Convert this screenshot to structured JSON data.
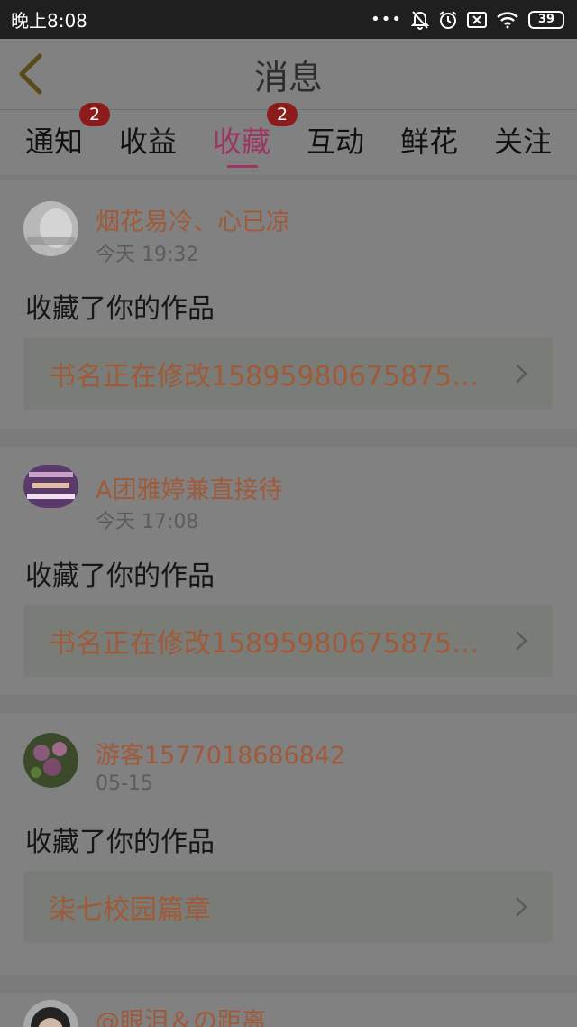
{
  "status_bar": {
    "time": "晚上8:08",
    "icons": [
      "more-dots-icon",
      "mute-bell-icon",
      "alarm-icon",
      "sim-x-icon",
      "wifi-icon"
    ],
    "battery": "39"
  },
  "header": {
    "back_icon": "chevron-left-icon",
    "title": "消息"
  },
  "tabs": [
    {
      "label": "通知",
      "badge": "2"
    },
    {
      "label": "收益",
      "badge": ""
    },
    {
      "label": "收藏",
      "badge": "2",
      "active": true
    },
    {
      "label": "互动",
      "badge": ""
    },
    {
      "label": "鲜花",
      "badge": ""
    },
    {
      "label": "关注",
      "badge": ""
    }
  ],
  "colors": {
    "accent": "#9c3660",
    "badge": "#8c1c1c",
    "username": "#a05a3a"
  },
  "messages": [
    {
      "username": "烟花易冷、心已凉",
      "time": "今天 19:32",
      "action": "收藏了你的作品",
      "work_title": "书名正在修改15895980675875…",
      "avatar_icon": "avatar-image"
    },
    {
      "username": "A团雅婷兼直接待",
      "time": "今天 17:08",
      "action": "收藏了你的作品",
      "work_title": "书名正在修改15895980675875…",
      "avatar_icon": "avatar-image"
    },
    {
      "username": "游客1577018686842",
      "time": "05-15",
      "action": "收藏了你的作品",
      "work_title": "柒七校园篇章",
      "avatar_icon": "avatar-image"
    },
    {
      "username": "@眼泪＆の距离",
      "time": "",
      "action": "",
      "work_title": "",
      "avatar_icon": "avatar-image"
    }
  ]
}
